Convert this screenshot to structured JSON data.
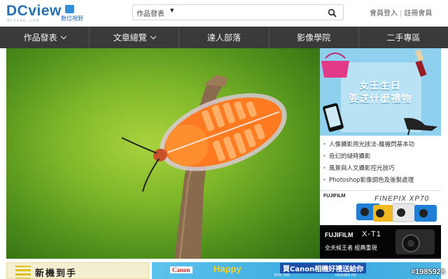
{
  "header": {
    "logo_text": "DCview",
    "logo_sub": "dcview.com",
    "logo_cn": "數位視野",
    "search": {
      "category": "作品發表",
      "placeholder": ""
    },
    "auth": {
      "login": "會員登入",
      "register": "註冊會員"
    }
  },
  "nav": {
    "items": [
      {
        "label": "作品發表",
        "dropdown": true
      },
      {
        "label": "文章總覽",
        "dropdown": true
      },
      {
        "label": "達人部落",
        "dropdown": false
      },
      {
        "label": "影像學院",
        "dropdown": false
      },
      {
        "label": "二手專區",
        "dropdown": false
      }
    ]
  },
  "hero": {
    "icon": "insect-photo"
  },
  "sidebar": {
    "banner": {
      "title": "女王生日",
      "subtitle": "要送什麼禮物"
    },
    "links": [
      "人像攝影用光技法-離機閃基本功",
      "奇幻的縫時攝影",
      "風景與人文攝影控光技巧",
      "Photoshop影像調色及後製處理"
    ],
    "fuji_ad_1": {
      "brand": "FUJIFILM",
      "model": "FINEPIX XP70"
    },
    "fuji_ad_2": {
      "brand": "FUJIFILM",
      "model": "X-T1",
      "tagline": "全天候王者 經典重現"
    }
  },
  "bottom_ads": {
    "left": {
      "text": "新機到手"
    },
    "right": {
      "brand": "Canon",
      "headline": "Happy",
      "promo": "買Canon相機好禮送給你",
      "model_1": "EOS 70D",
      "model_2": "IXUS265 HS"
    }
  },
  "watermark": "#1985928",
  "colors": {
    "nav_bg": "#3a3a3a",
    "brand_blue": "#2a6fb3",
    "banner_blue": "#8fd0ee"
  }
}
